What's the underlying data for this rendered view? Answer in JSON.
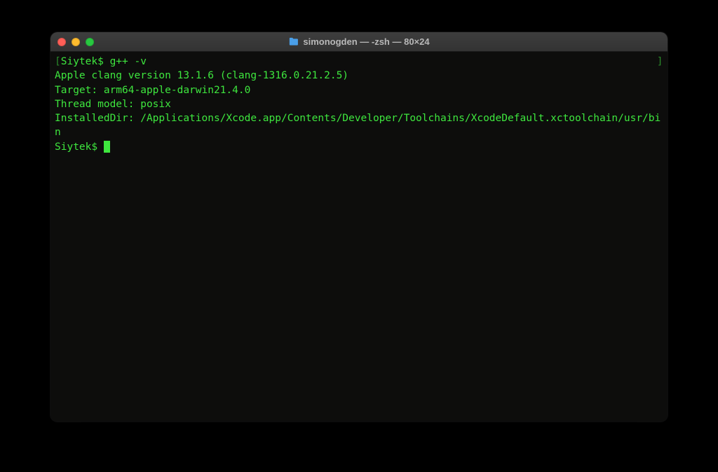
{
  "window": {
    "title": "simonogden — -zsh — 80×24"
  },
  "terminal": {
    "prompt1_bracket": "[",
    "prompt1_text": "Siytek$ g++ -v",
    "prompt1_end": "]",
    "output": [
      "Apple clang version 13.1.6 (clang-1316.0.21.2.5)",
      "Target: arm64-apple-darwin21.4.0",
      "Thread model: posix",
      "InstalledDir: /Applications/Xcode.app/Contents/Developer/Toolchains/XcodeDefault.xctoolchain/usr/bin"
    ],
    "prompt2": "Siytek$ "
  },
  "colors": {
    "terminal_text": "#3ee63e",
    "terminal_bg": "#0d0d0c",
    "titlebar_text": "#b8b8b8"
  }
}
